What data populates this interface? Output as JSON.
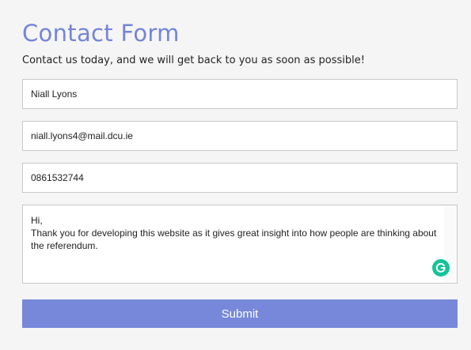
{
  "header": {
    "title": "Contact Form",
    "subtitle": "Contact us today, and we will get back to you as soon as possible!"
  },
  "form": {
    "name_value": "Niall Lyons",
    "email_value": "niall.lyons4@mail.dcu.ie",
    "phone_value": "0861532744",
    "message_value": "Hi,\nThank you for developing this website as it gives great insight into how people are thinking about the referendum.",
    "submit_label": "Submit"
  },
  "icons": {
    "grammarly": "grammarly-icon"
  },
  "colors": {
    "accent": "#7787d9",
    "title": "#7484d8",
    "grammarly": "#15c39a",
    "background": "#f5f5f5"
  }
}
